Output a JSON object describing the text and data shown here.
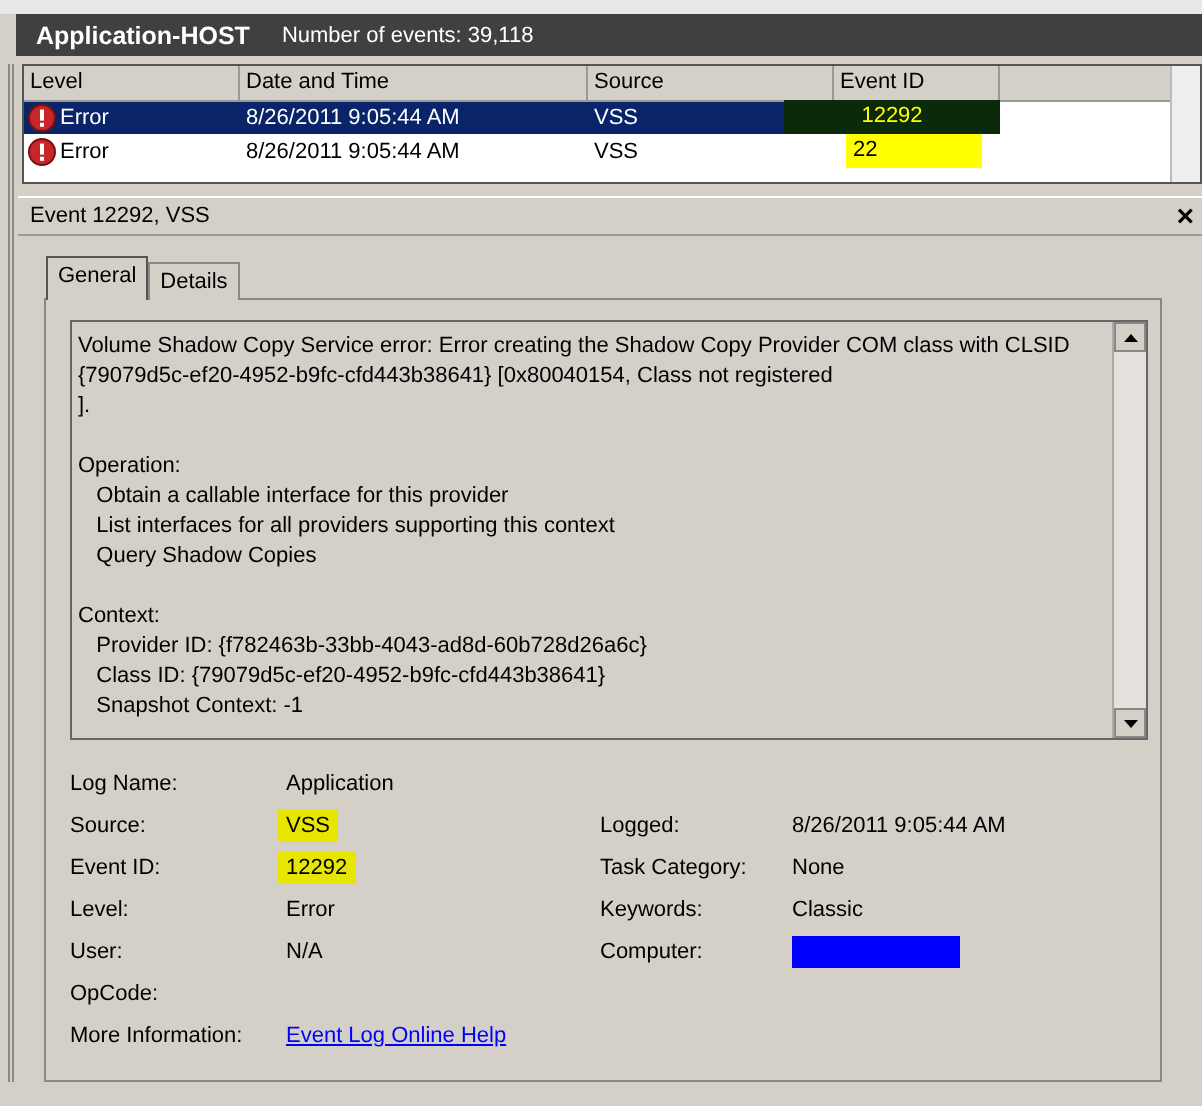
{
  "header": {
    "title": "Application-HOST",
    "count": "Number of events: 39,118"
  },
  "table": {
    "columns": [
      "Level",
      "Date and Time",
      "Source",
      "Event ID"
    ],
    "rows": [
      {
        "level": "Error",
        "date": "8/26/2011 9:05:44 AM",
        "source": "VSS",
        "event_id": "12292",
        "selected": true,
        "id_highlighted": true
      },
      {
        "level": "Error",
        "date": "8/26/2011 9:05:44 AM",
        "source": "VSS",
        "event_id": "22",
        "selected": false,
        "id_highlighted": true
      }
    ]
  },
  "event_panel": {
    "title": "Event 12292, VSS",
    "close": "×",
    "tabs": [
      {
        "label": "General",
        "selected": true
      },
      {
        "label": "Details",
        "selected": false
      }
    ],
    "message": "Volume Shadow Copy Service error: Error creating the Shadow Copy Provider COM class with CLSID {79079d5c-ef20-4952-b9fc-cfd443b38641} [0x80040154, Class not registered\n].\n\nOperation:\n   Obtain a callable interface for this provider\n   List interfaces for all providers supporting this context\n   Query Shadow Copies\n\nContext:\n   Provider ID: {f782463b-33bb-4043-ad8d-60b728d26a6c}\n   Class ID: {79079d5c-ef20-4952-b9fc-cfd443b38641}\n   Snapshot Context: -1",
    "fields_left": [
      {
        "label": "Log Name:",
        "value": "Application"
      },
      {
        "label": "Source:",
        "value": "VSS",
        "highlighted": true
      },
      {
        "label": "Event ID:",
        "value": "12292",
        "highlighted": true
      },
      {
        "label": "Level:",
        "value": "Error"
      },
      {
        "label": "User:",
        "value": "N/A"
      },
      {
        "label": "OpCode:"
      }
    ],
    "fields_right": [
      {
        "label": "Logged:",
        "value": "8/26/2011 9:05:44 AM",
        "redacted": false
      },
      {
        "label": "Task Category:",
        "value": "None",
        "redacted": false
      },
      {
        "label": "Keywords:",
        "value": "Classic",
        "redacted": false
      },
      {
        "label": "Computer:",
        "redacted": true
      }
    ],
    "more_info": {
      "label": "More Information:",
      "link": "Event Log Online Help"
    }
  }
}
